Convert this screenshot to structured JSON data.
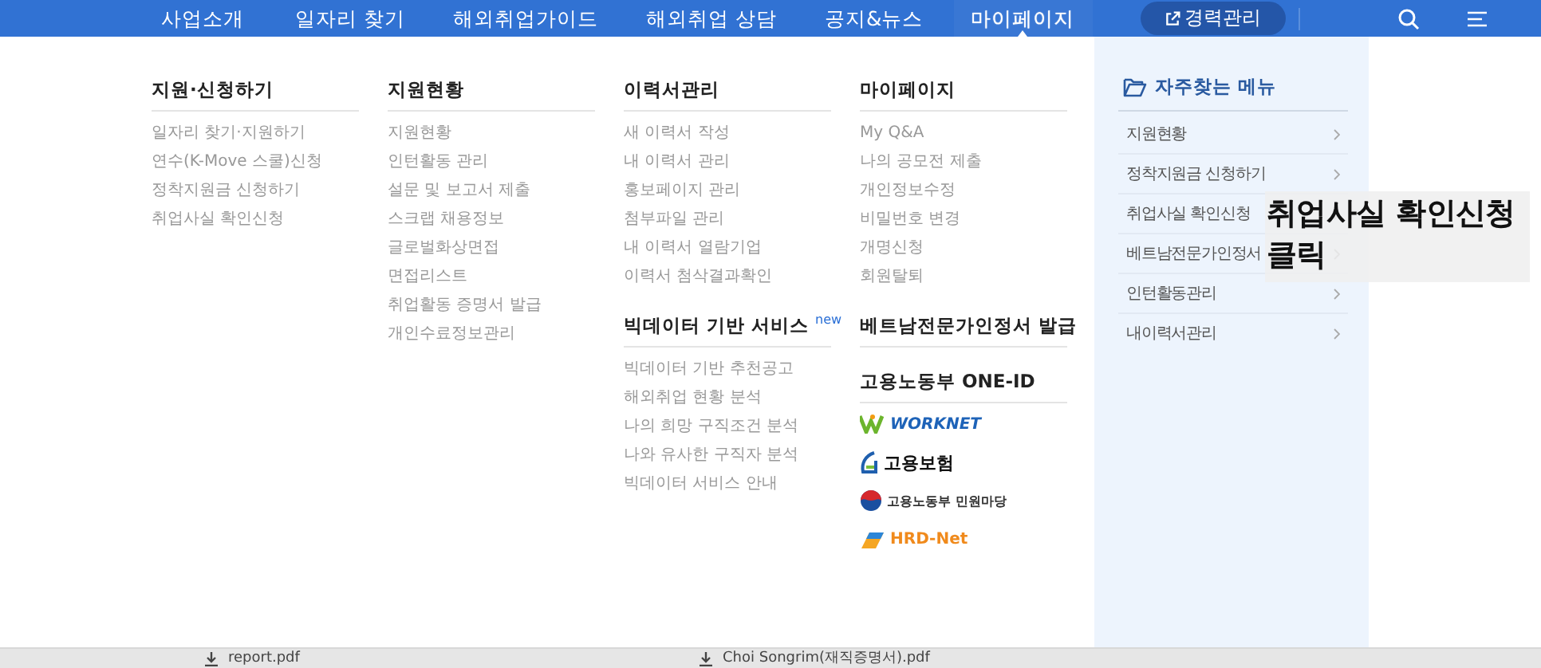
{
  "nav": {
    "items": [
      {
        "label": "사업소개",
        "selected": false
      },
      {
        "label": "일자리 찾기",
        "selected": false
      },
      {
        "label": "해외취업가이드",
        "selected": false
      },
      {
        "label": "해외취업 상담",
        "selected": false
      },
      {
        "label": "공지&뉴스",
        "selected": false
      },
      {
        "label": "마이페이지",
        "selected": true
      }
    ],
    "career_button": "경력관리"
  },
  "menu": {
    "columns": [
      {
        "sections": [
          {
            "title": "지원·신청하기",
            "items": [
              "일자리 찾기·지원하기",
              "연수(K-Move 스쿨)신청",
              "정착지원금 신청하기",
              "취업사실 확인신청"
            ]
          }
        ]
      },
      {
        "sections": [
          {
            "title": "지원현황",
            "items": [
              "지원현황",
              "인턴활동 관리",
              "설문 및 보고서 제출",
              "스크랩 채용정보",
              "글로벌화상면접",
              "면접리스트",
              "취업활동 증명서 발급",
              "개인수료정보관리"
            ]
          }
        ]
      },
      {
        "sections": [
          {
            "title": "이력서관리",
            "items": [
              "새 이력서 작성",
              "내 이력서 관리",
              "홍보페이지 관리",
              "첨부파일 관리",
              "내 이력서 열람기업",
              "이력서 첨삭결과확인"
            ]
          },
          {
            "title": "빅데이터 기반 서비스",
            "badge": "new",
            "items": [
              "빅데이터 기반 추천공고",
              "해외취업 현황 분석",
              "나의 희망 구직조건 분석",
              "나와 유사한 구직자 분석",
              "빅데이터 서비스 안내"
            ]
          }
        ]
      },
      {
        "sections": [
          {
            "title": "마이페이지",
            "items": [
              "My Q&A",
              "나의 공모전 제출",
              "개인정보수정",
              "비밀번호 변경",
              "개명신청",
              "회원탈퇴"
            ]
          },
          {
            "title": "베트남전문가인정서 발급"
          },
          {
            "title": "고용노동부 ONE-ID",
            "logos": [
              {
                "kind": "worknet",
                "text": "WORKNET"
              },
              {
                "kind": "insurance",
                "text": "고용보험"
              },
              {
                "kind": "gov",
                "text": "고용노동부 민원마당"
              },
              {
                "kind": "hrd",
                "text": "HRD-Net"
              }
            ]
          }
        ]
      }
    ]
  },
  "favorites": {
    "title": "자주찾는 메뉴",
    "items": [
      "지원현황",
      "정착지원금 신청하기",
      "취업사실 확인신청",
      "베트남전문가인정서",
      "인턴활동관리",
      "내이력서관리"
    ]
  },
  "downloads": [
    "report.pdf",
    "Choi Songrim(재직증명서).pdf"
  ],
  "caption": "취업사실 확인신청\n클릭"
}
